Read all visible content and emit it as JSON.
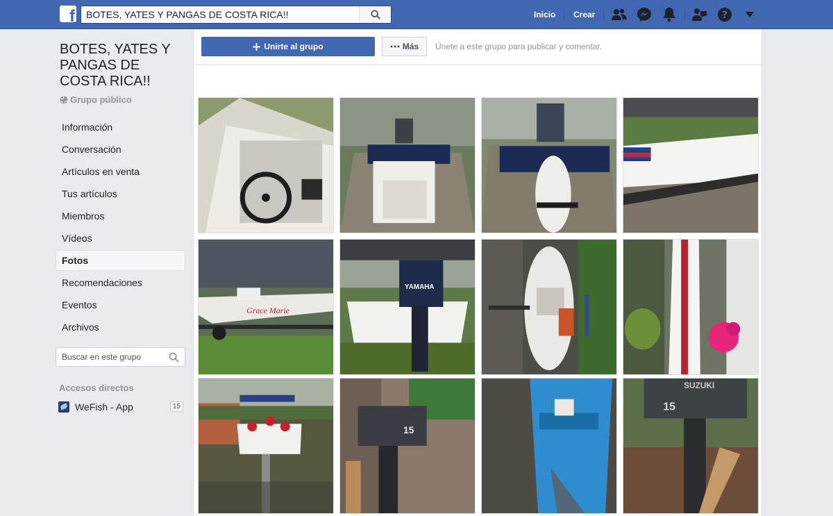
{
  "header": {
    "search_value": "BOTES, YATES Y PANGAS DE COSTA RICA!!",
    "nav_home": "Inicio",
    "nav_create": "Crear",
    "logo_letter": "f"
  },
  "group": {
    "title": "BOTES, YATES Y PANGAS DE COSTA RICA!!",
    "type": "Grupo público"
  },
  "menu": {
    "items": [
      {
        "label": "Información"
      },
      {
        "label": "Conversación"
      },
      {
        "label": "Artículos en venta"
      },
      {
        "label": "Tus artículos"
      },
      {
        "label": "Miembros"
      },
      {
        "label": "Vídeos"
      },
      {
        "label": "Fotos"
      },
      {
        "label": "Recomendaciones"
      },
      {
        "label": "Eventos"
      },
      {
        "label": "Archivos"
      }
    ]
  },
  "group_search": {
    "placeholder": "Buscar en este grupo"
  },
  "shortcuts": {
    "title": "Accesos directos",
    "items": [
      {
        "label": "WeFish - App",
        "count": "15"
      }
    ]
  },
  "actions": {
    "join_label": "Unirte al grupo",
    "more_label": "Más",
    "hint": "Únete a este grupo para publicar y comentar."
  },
  "photo_texts": {
    "grace_marie": "Grace Marie",
    "yamaha": "YAMAHA",
    "suzuki": "SUZUKI",
    "fifteen": "15"
  },
  "colors": {
    "brand_blue": "#4267b2",
    "background": "#e9ebee"
  }
}
